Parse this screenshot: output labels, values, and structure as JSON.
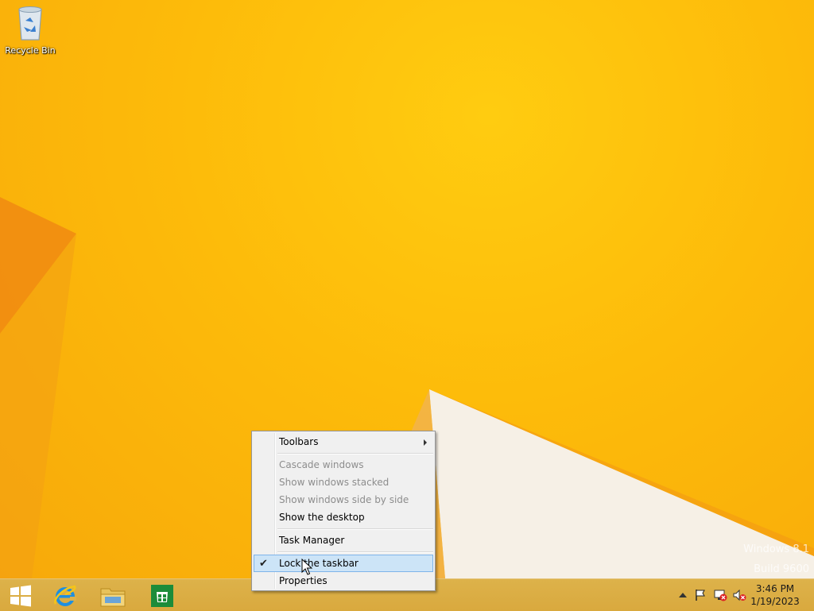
{
  "desktop": {
    "icons": [
      {
        "label": "Recycle Bin",
        "icon": "recycle-bin-icon"
      }
    ],
    "watermark": {
      "line1": "Windows 8.1",
      "line2": "Build 9600"
    }
  },
  "taskbar": {
    "pinned": [
      {
        "name": "start",
        "icon": "windows-logo-icon"
      },
      {
        "name": "internet-explorer",
        "icon": "internet-explorer-icon"
      },
      {
        "name": "file-explorer",
        "icon": "file-explorer-icon"
      },
      {
        "name": "store",
        "icon": "store-icon"
      }
    ],
    "tray": {
      "icons": [
        "show-hidden-icons-arrow",
        "action-center-flag-icon",
        "network-disconnected-icon",
        "volume-muted-icon"
      ],
      "time": "3:46 PM",
      "date": "1/19/2023"
    }
  },
  "context_menu": {
    "items": [
      {
        "label": "Toolbars",
        "has_submenu": true,
        "enabled": true
      },
      {
        "label": "Cascade windows",
        "enabled": false
      },
      {
        "label": "Show windows stacked",
        "enabled": false
      },
      {
        "label": "Show windows side by side",
        "enabled": false
      },
      {
        "label": "Show the desktop",
        "enabled": true
      },
      {
        "label": "Task Manager",
        "enabled": true
      },
      {
        "label": "Lock the taskbar",
        "enabled": true,
        "checked": true,
        "highlighted": true
      },
      {
        "label": "Properties",
        "enabled": true
      }
    ]
  },
  "colors": {
    "accent": "#fdbb0a",
    "menu_highlight": "#cce4f7",
    "menu_highlight_border": "#7eb4ea"
  }
}
